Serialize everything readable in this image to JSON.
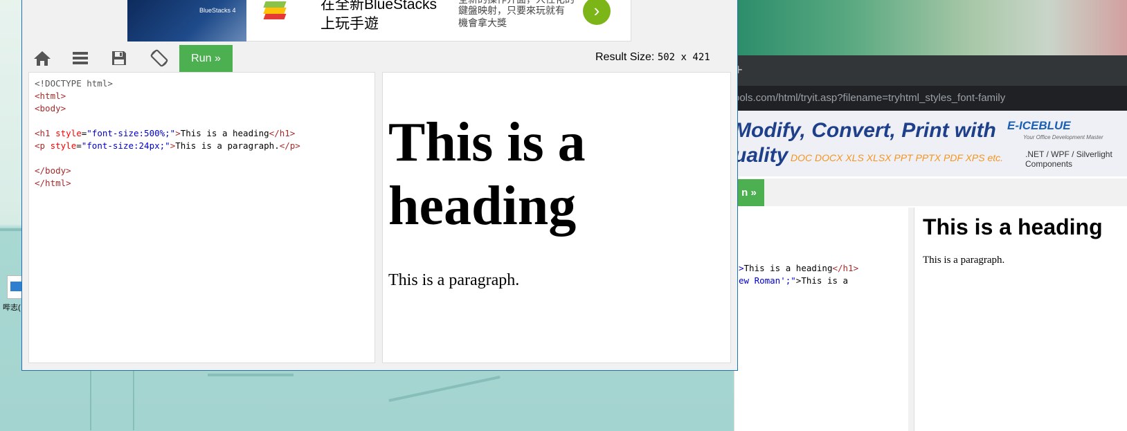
{
  "ad": {
    "title_line1": "在全新BlueStacks",
    "title_line2": "上玩手遊",
    "desc_line1": "全新的操作介面，人性化的",
    "desc_line2": "鍵盤映射，只要來玩就有",
    "desc_line3": "機會拿大獎",
    "image_label": "BlueStacks 4",
    "cta_icon": "chevron-right-icon"
  },
  "toolbar": {
    "home_icon": "home-icon",
    "menu_icon": "menu-icon",
    "save_icon": "save-icon",
    "rotate_icon": "rotate-icon",
    "run_label": "Run »",
    "result_size_label": "Result Size:",
    "result_size_value": "502 x 421"
  },
  "code": {
    "line1": "<!DOCTYPE html>",
    "line2": "<html>",
    "line3": "<body>",
    "line5_open": "<h1",
    "line5_attr": " style",
    "line5_eq": "=",
    "line5_val": "\"font-size:500%;\"",
    "line5_close_open": ">",
    "line5_text": "This is a heading",
    "line5_end": "</h1>",
    "line6_open": "<p",
    "line6_attr": " style",
    "line6_eq": "=",
    "line6_val": "\"font-size:24px;\"",
    "line6_close_open": ">",
    "line6_text": "This is a paragraph.",
    "line6_end": "</p>",
    "line8": "</body>",
    "line9": "</html>"
  },
  "result": {
    "heading": "This is a heading",
    "paragraph": "This is a paragraph."
  },
  "background_browser": {
    "new_tab": "+",
    "url": "ools.com/html/tryit.asp?filename=tryhtml_styles_font-family",
    "ad_line1": "Modify, Convert, Print with",
    "ad_line2": "uality",
    "ad_formats": "DOC  DOCX  XLS  XLSX  PPT  PPTX  PDF  XPS  etc.",
    "ad_brand": "E-ICEBLUE",
    "ad_tagline": "Your Office Development Master",
    "ad_platforms_line1": ".NET / WPF / Silverlight",
    "ad_platforms_line2": "Components",
    "run_label": "n »",
    "code_line1_open": ">",
    "code_line1_text": "This is a heading",
    "code_line1_end": "</h1>",
    "code_line2_val": "ew Roman';\"",
    "code_line2_text": ">This is a",
    "result_heading": "This is a heading",
    "result_paragraph": "This is a paragraph."
  },
  "desktop": {
    "shortcut_label": "哔志("
  },
  "colors": {
    "run_green": "#4caf50",
    "tag_brown": "brown",
    "attr_red": "red",
    "value_blue": "mediumblue"
  }
}
